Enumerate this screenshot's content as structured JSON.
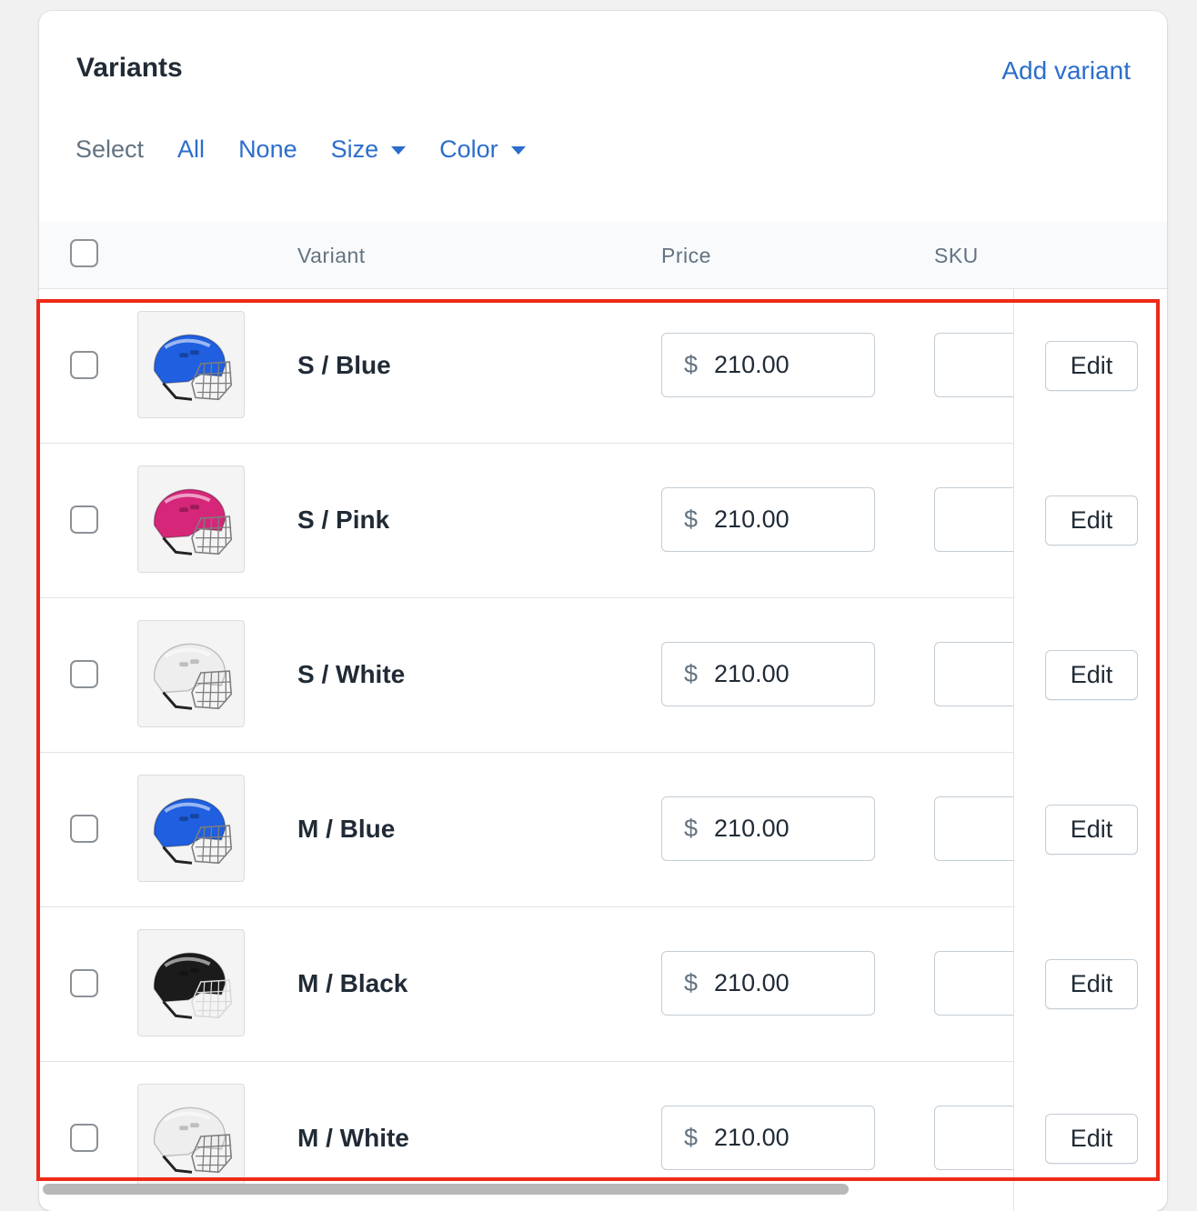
{
  "card": {
    "title": "Variants",
    "add_variant_label": "Add variant"
  },
  "select_bar": {
    "label": "Select",
    "all": "All",
    "none": "None",
    "size": "Size",
    "color": "Color"
  },
  "table": {
    "headers": {
      "variant": "Variant",
      "price": "Price",
      "sku": "SKU"
    },
    "rows": [
      {
        "name": "S / Blue",
        "currency": "$",
        "price": "210.00",
        "edit": "Edit",
        "helmet_color": "#1f5fe0",
        "image": "blue-helmet-icon"
      },
      {
        "name": "S / Pink",
        "currency": "$",
        "price": "210.00",
        "edit": "Edit",
        "helmet_color": "#d6267a",
        "image": "pink-helmet-icon"
      },
      {
        "name": "S / White",
        "currency": "$",
        "price": "210.00",
        "edit": "Edit",
        "helmet_color": "#eeeeee",
        "image": "white-helmet-icon"
      },
      {
        "name": "M / Blue",
        "currency": "$",
        "price": "210.00",
        "edit": "Edit",
        "helmet_color": "#1f5fe0",
        "image": "blue-helmet-icon"
      },
      {
        "name": "M / Black",
        "currency": "$",
        "price": "210.00",
        "edit": "Edit",
        "helmet_color": "#1b1b1b",
        "image": "black-helmet-icon"
      },
      {
        "name": "M / White",
        "currency": "$",
        "price": "210.00",
        "edit": "Edit",
        "helmet_color": "#eeeeee",
        "image": "white-helmet-icon"
      }
    ]
  },
  "colors": {
    "link": "#2c6ecb",
    "highlight": "#ee2a17"
  }
}
